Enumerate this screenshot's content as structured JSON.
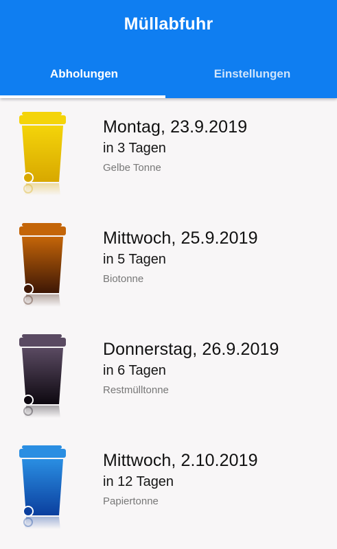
{
  "app": {
    "title": "Müllabfuhr"
  },
  "tabs": [
    {
      "label": "Abholungen",
      "selected": true
    },
    {
      "label": "Einstellungen",
      "selected": false
    }
  ],
  "colors": {
    "appbar": "#0f7ef1",
    "background": "#f8f6f7"
  },
  "pickups": [
    {
      "date": "Montag, 23.9.2019",
      "days": "in 3 Tagen",
      "type": "Gelbe Tonne",
      "bin_icon": "yellow-bin-icon",
      "color_top": "#f4d40a",
      "color_bottom": "#d8a800"
    },
    {
      "date": "Mittwoch, 25.9.2019",
      "days": "in 5 Tagen",
      "type": "Biotonne",
      "bin_icon": "brown-bin-icon",
      "color_top": "#c46508",
      "color_bottom": "#3e1705"
    },
    {
      "date": "Donnerstag, 26.9.2019",
      "days": "in 6 Tagen",
      "type": "Restmülltonne",
      "bin_icon": "black-bin-icon",
      "color_top": "#5a4a62",
      "color_bottom": "#0d0810"
    },
    {
      "date": "Mittwoch, 2.10.2019",
      "days": "in 12 Tagen",
      "type": "Papiertonne",
      "bin_icon": "blue-bin-icon",
      "color_top": "#2a8ee2",
      "color_bottom": "#0b3f9e"
    }
  ]
}
